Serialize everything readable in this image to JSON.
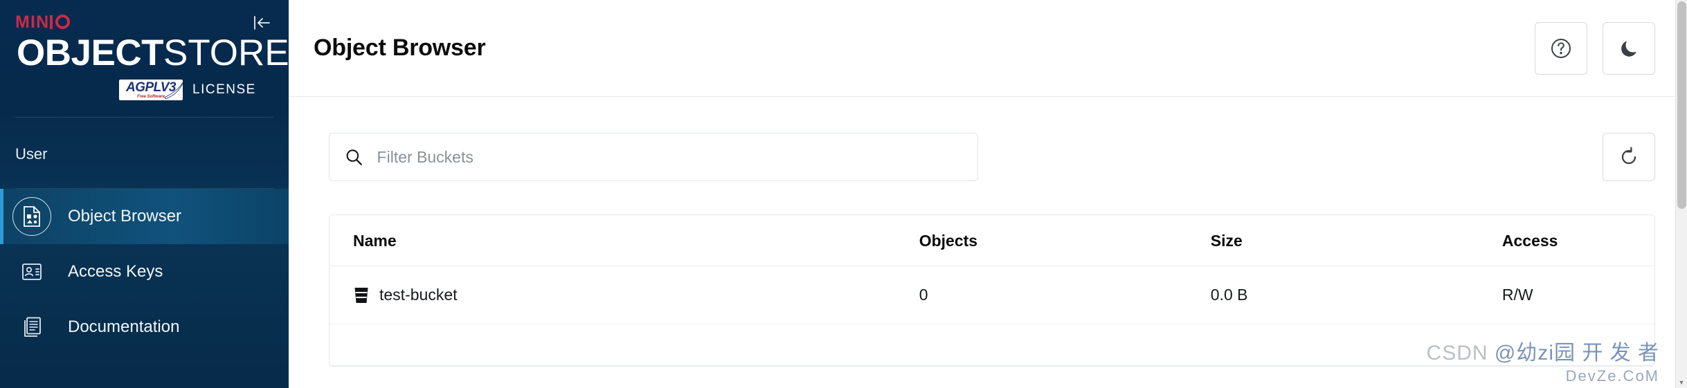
{
  "sidebar": {
    "collapse_icon": "collapse-left-icon",
    "logo": {
      "brand": "MINIO",
      "title_bold": "OBJECT",
      "title_light": "STORE",
      "license_badge_top": "AGPLV3",
      "license_badge_sub": "Free Software",
      "license_word": "LICENSE"
    },
    "section_label": "User",
    "items": [
      {
        "label": "Object Browser",
        "icon": "object-browser-icon",
        "active": true
      },
      {
        "label": "Access Keys",
        "icon": "access-keys-icon",
        "active": false
      },
      {
        "label": "Documentation",
        "icon": "documentation-icon",
        "active": false
      }
    ]
  },
  "header": {
    "title": "Object Browser",
    "help_icon": "help-circle-icon",
    "dark_mode_icon": "moon-icon"
  },
  "toolbar": {
    "search_placeholder": "Filter Buckets",
    "search_value": "",
    "search_icon": "search-icon",
    "refresh_icon": "refresh-icon"
  },
  "table": {
    "columns": [
      "Name",
      "Objects",
      "Size",
      "Access"
    ],
    "rows": [
      {
        "name": "test-bucket",
        "objects": "0",
        "size": "0.0 B",
        "access": "R/W",
        "icon": "bucket-icon"
      }
    ]
  },
  "watermark": {
    "line1_left": "CSDN ",
    "line1_right": "@幼zi园 开 发 者",
    "line2": "DevZe.CoM"
  },
  "colors": {
    "sidebar_bg": "#072b4e",
    "sidebar_active": "#10527c",
    "accent_red": "#c72c48",
    "accent_blue": "#2e9bd6",
    "text_dark": "#0c0c0c"
  }
}
